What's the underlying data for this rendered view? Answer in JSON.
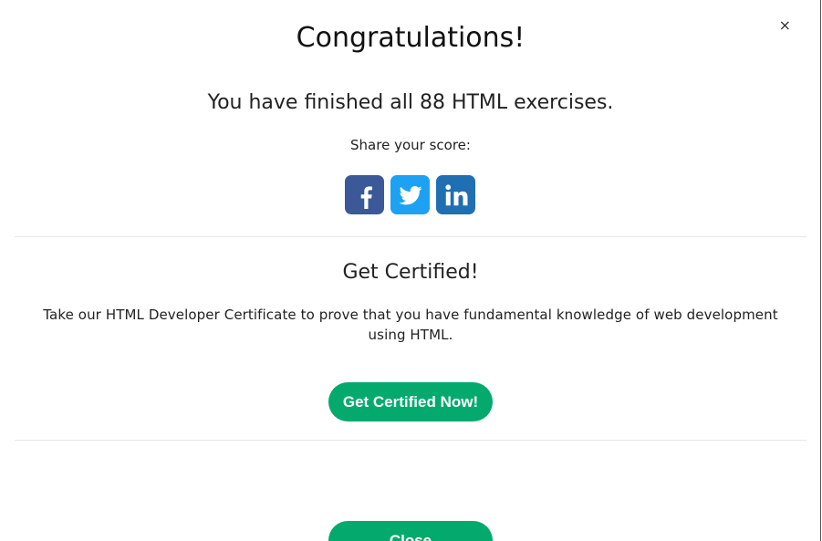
{
  "dialog": {
    "close_glyph": "×",
    "title": "Congratulations!",
    "subtitle": "You have finished all 88 HTML exercises.",
    "share_label": "Share your score:",
    "share_icons": [
      "facebook-icon",
      "twitter-icon",
      "linkedin-icon"
    ],
    "cert_title": "Get Certified!",
    "cert_text": "Take our HTML Developer Certificate to prove that you have fundamental knowledge of web development using HTML.",
    "cert_button": "Get Certified Now!",
    "close_button": "Close"
  },
  "colors": {
    "accent_green": "#04aa6d",
    "facebook": "#3b5998",
    "twitter": "#1da1f2",
    "linkedin": "#1f6fb2"
  }
}
